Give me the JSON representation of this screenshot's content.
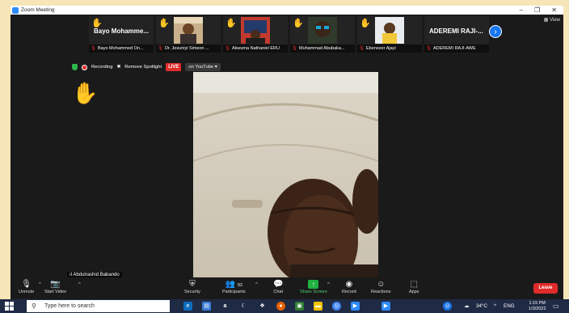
{
  "window": {
    "title": "Zoom Meeting",
    "controls": [
      "–",
      "❐",
      "✕"
    ]
  },
  "strip": {
    "tiles": [
      {
        "label": "Bayo Mohamme...",
        "caption": "Bayo Mohammed On...",
        "hand": true
      },
      {
        "label": "",
        "caption": "Dr. Jesuniyi Simeon ...",
        "hand": true
      },
      {
        "label": "",
        "caption": "Akwuma Nathaniel ERU",
        "hand": true
      },
      {
        "label": "",
        "caption": "Muhammad Abubaka...",
        "hand": true
      },
      {
        "label": "",
        "caption": "Ebenezer Ajayi",
        "hand": true
      },
      {
        "label": "ADEREMI RAJI-...",
        "caption": "ADEREMI RAJI-AWE",
        "hand": false
      }
    ],
    "next_icon": "chevron-right-icon",
    "view_label": "View"
  },
  "status": {
    "recording": "Recording",
    "remove_spotlight": "Remove Spotlight",
    "live": "LIVE",
    "live_on": "on YouTube"
  },
  "speaker": {
    "name": "Abdulrashid Babando"
  },
  "toolbar": {
    "unmute": "Unmute",
    "start_video": "Start Video",
    "security": "Security",
    "participants": "Participants",
    "participant_count": "92",
    "chat": "Chat",
    "share_screen": "Share Screen",
    "record": "Record",
    "reactions": "Reactions",
    "apps": "Apps",
    "leave": "Leave"
  },
  "taskbar": {
    "search_placeholder": "Type here to search",
    "weather": "34°C",
    "language": "ENG",
    "time": "1:15 PM",
    "date": "1/3/2022"
  },
  "colors": {
    "zoom_blue": "#2d8cff",
    "leave_red": "#e02b2b",
    "share_green": "#1fb141",
    "hand_yellow": "#f2c200"
  }
}
